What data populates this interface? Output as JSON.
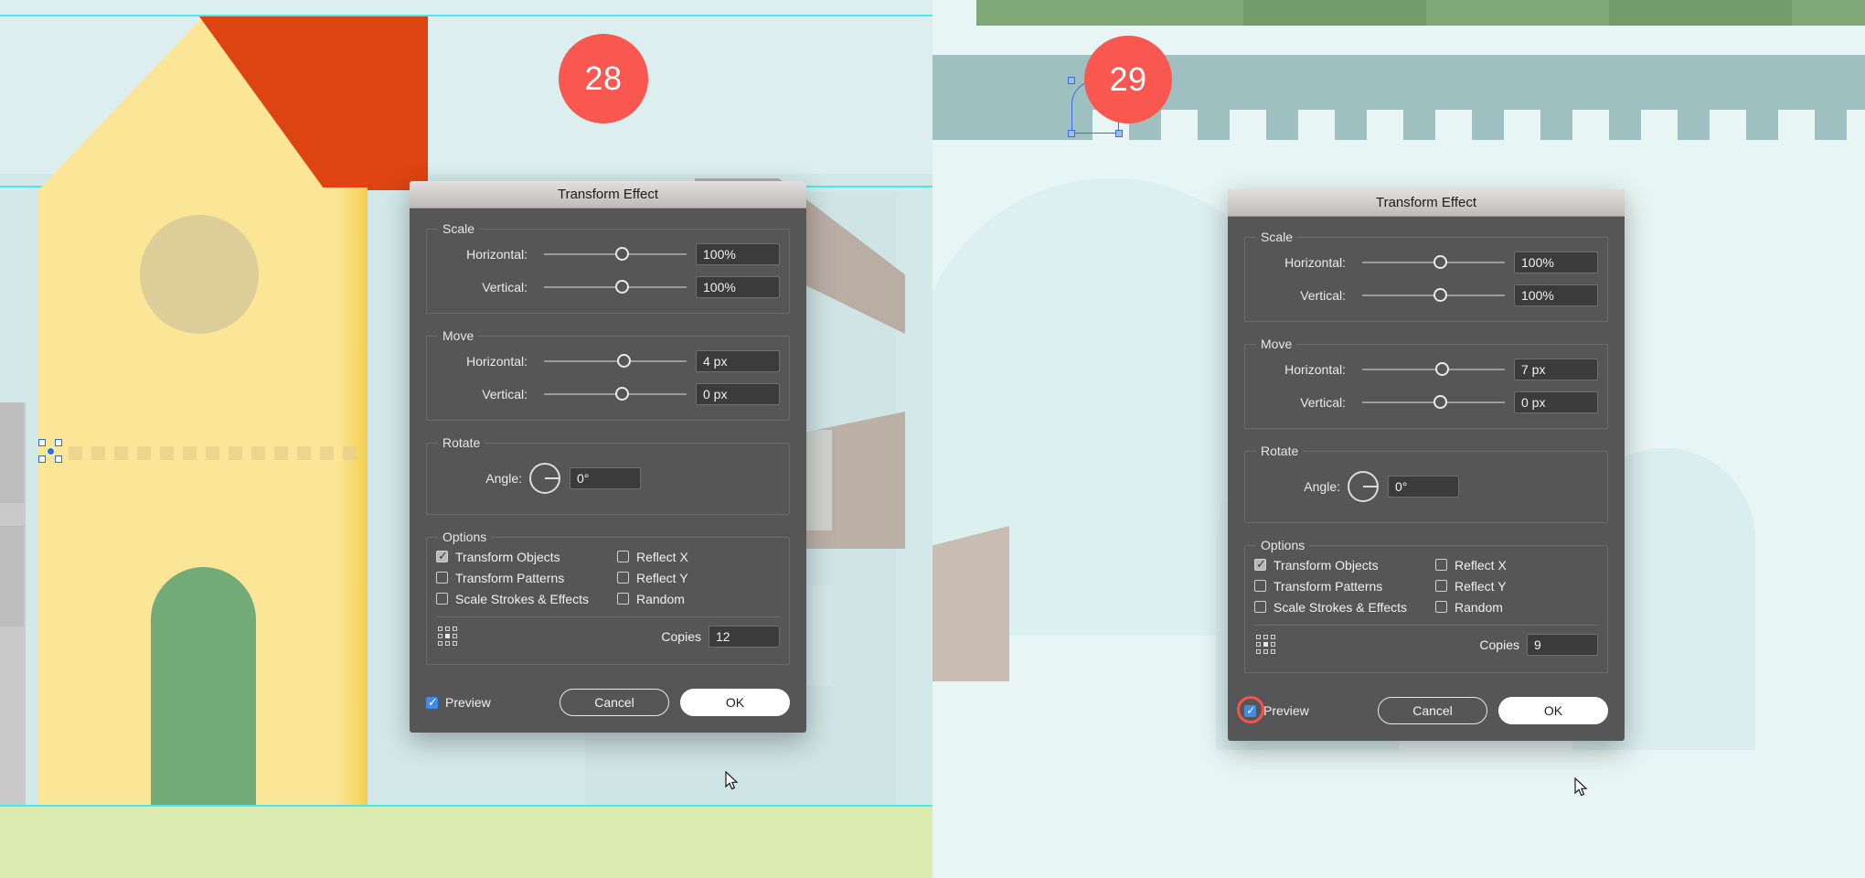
{
  "badges": {
    "left": "28",
    "right": "29",
    "color": "#fa5750"
  },
  "dialog_left": {
    "title": "Transform Effect",
    "scale": {
      "legend": "Scale",
      "horizontal_label": "Horizontal:",
      "horizontal_value": "100%",
      "vertical_label": "Vertical:",
      "vertical_value": "100%"
    },
    "move": {
      "legend": "Move",
      "horizontal_label": "Horizontal:",
      "horizontal_value": "4 px",
      "vertical_label": "Vertical:",
      "vertical_value": "0 px"
    },
    "rotate": {
      "legend": "Rotate",
      "angle_label": "Angle:",
      "angle_value": "0°"
    },
    "options": {
      "legend": "Options",
      "transform_objects": "Transform Objects",
      "transform_objects_checked": true,
      "transform_patterns": "Transform Patterns",
      "transform_patterns_checked": false,
      "scale_strokes": "Scale Strokes & Effects",
      "scale_strokes_checked": false,
      "reflect_x": "Reflect X",
      "reflect_x_checked": false,
      "reflect_y": "Reflect Y",
      "reflect_y_checked": false,
      "random": "Random",
      "random_checked": false
    },
    "copies_label": "Copies",
    "copies_value": "12",
    "preview_label": "Preview",
    "preview_checked": true,
    "cancel_label": "Cancel",
    "ok_label": "OK"
  },
  "dialog_right": {
    "title": "Transform Effect",
    "scale": {
      "legend": "Scale",
      "horizontal_label": "Horizontal:",
      "horizontal_value": "100%",
      "vertical_label": "Vertical:",
      "vertical_value": "100%"
    },
    "move": {
      "legend": "Move",
      "horizontal_label": "Horizontal:",
      "horizontal_value": "7 px",
      "vertical_label": "Vertical:",
      "vertical_value": "0 px"
    },
    "rotate": {
      "legend": "Rotate",
      "angle_label": "Angle:",
      "angle_value": "0°"
    },
    "options": {
      "legend": "Options",
      "transform_objects": "Transform Objects",
      "transform_objects_checked": true,
      "transform_patterns": "Transform Patterns",
      "transform_patterns_checked": false,
      "scale_strokes": "Scale Strokes & Effects",
      "scale_strokes_checked": false,
      "reflect_x": "Reflect X",
      "reflect_x_checked": false,
      "reflect_y": "Reflect Y",
      "reflect_y_checked": false,
      "random": "Random",
      "random_checked": false
    },
    "copies_label": "Copies",
    "copies_value": "9",
    "preview_label": "Preview",
    "preview_checked": true,
    "cancel_label": "Cancel",
    "ok_label": "OK"
  },
  "artwork": {
    "left": {
      "house_body_color": "#fbe697",
      "roof_color": "#dd4412",
      "window_color": "#ddcd98",
      "door_color": "#72ab77",
      "guide_color": "#31e8e8",
      "ground_color": "#dcecb0",
      "copies_visible": 13
    },
    "right": {
      "green_band_color": "#7fa878",
      "wall_color": "#9fc0c1",
      "sky_color": "#e7f5f4",
      "selection_color": "#3b6fe0",
      "crenellations": 13
    }
  }
}
